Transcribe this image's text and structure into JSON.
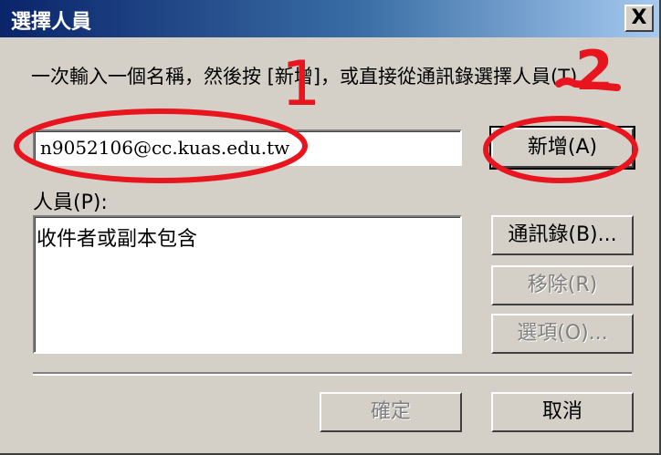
{
  "dialog": {
    "title": "選擇人員",
    "close_glyph": "X"
  },
  "instruction": "一次輸入一個名稱，然後按 [新增]，或直接從通訊錄選擇人員(T)",
  "name_input": {
    "value": "n9052106@cc.kuas.edu.tw"
  },
  "buttons": {
    "add": "新增(A)",
    "address_book": "通訊錄(B)...",
    "remove": "移除(R)",
    "options": "選項(O)...",
    "ok": "確定",
    "cancel": "取消"
  },
  "people": {
    "label": "人員(P):",
    "items": [
      "收件者或副本包含"
    ]
  },
  "annotations": {
    "step_1": "1",
    "step_2": "2",
    "color": "#e8141e"
  }
}
